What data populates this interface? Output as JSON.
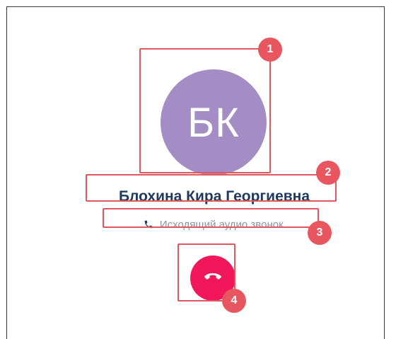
{
  "call": {
    "avatar_initials": "БК",
    "avatar_color": "#a48dc4",
    "contact_name": "Блохина Кира Георгиевна",
    "status_text": "Исходящий аудио звонок...",
    "status_icon": "phone-icon",
    "end_call_icon": "hangup-icon",
    "end_call_color": "#f0185a"
  },
  "annotations": {
    "badge_1": "1",
    "badge_2": "2",
    "badge_3": "3",
    "badge_4": "4",
    "color": "#e8565f"
  }
}
